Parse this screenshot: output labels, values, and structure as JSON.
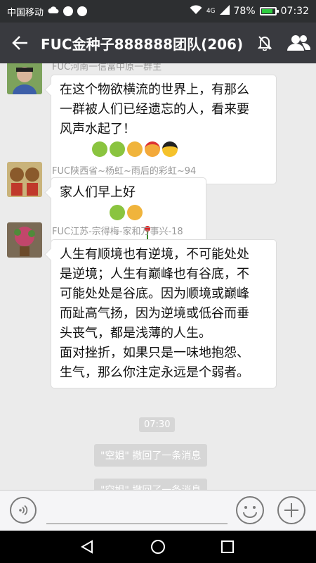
{
  "status_bar": {
    "carrier": "中国移动",
    "signal": "4G",
    "battery": "78%",
    "time": "07:32"
  },
  "header": {
    "title": "FUC金种子888888团队(206)",
    "back_icon": "back-arrow-icon",
    "mute_icon": "mute-bell-icon",
    "members_icon": "group-members-icon"
  },
  "messages": [
    {
      "sender": "FUC河南一信富中原一群主",
      "text_lines": [
        "在这个物欲横流的世界上，有那么",
        "一群被人们已经遗忘的人，看来要",
        "风声水起了！"
      ],
      "emojis": [
        "frog-emoji",
        "frog-emoji",
        "fist-emoji",
        "ninja-emoji",
        "cool-emoji"
      ]
    },
    {
      "sender": "FUC陕西省~杨虹~雨后的彩虹~94",
      "text_lines": [
        "家人们早上好"
      ],
      "emojis": [
        "rose-emoji",
        "frog-emoji",
        "fist-emoji"
      ]
    },
    {
      "sender": "FUC江苏-宗得梅-家和万事兴-18",
      "text_lines": [
        "人生有顺境也有逆境，不可能处处",
        "是逆境；人生有巅峰也有谷底，不",
        "可能处处是谷底。因为顺境或巅峰",
        "而趾高气扬，因为逆境或低谷而垂",
        "头丧气，都是浅薄的人生。",
        "面对挫折，如果只是一味地抱怨、",
        "生气，那么你注定永远是个弱者。"
      ],
      "emojis": []
    }
  ],
  "timestamp": "07:30",
  "system_messages": [
    "\"空姐\" 撤回了一条消息",
    "\"空姐\" 撤回了一条消息"
  ],
  "input": {
    "placeholder": ""
  },
  "colors": {
    "header_bg": "#393a3f",
    "chat_bg": "#ebebeb",
    "status_bg": "#2d2f31"
  }
}
